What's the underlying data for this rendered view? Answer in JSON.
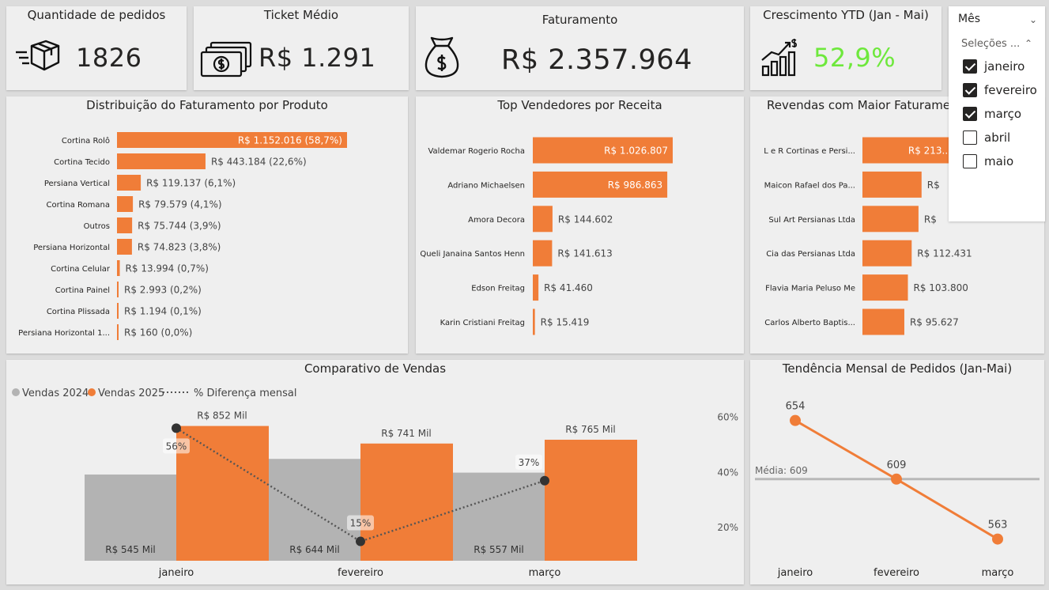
{
  "kpis": {
    "pedidos": {
      "title": "Quantidade de pedidos",
      "value": "1826"
    },
    "ticket": {
      "title": "Ticket Médio",
      "value": "R$ 1.291"
    },
    "faturamento": {
      "title": "Faturamento",
      "value": "R$ 2.357.964"
    },
    "crescimento": {
      "title": "Crescimento YTD (Jan - Mai)",
      "value": "52,9%"
    }
  },
  "slicer": {
    "title": "Mês",
    "selection_label": "Seleções ...",
    "options": [
      {
        "label": "janeiro",
        "checked": true
      },
      {
        "label": "fevereiro",
        "checked": true
      },
      {
        "label": "março",
        "checked": true
      },
      {
        "label": "abril",
        "checked": false
      },
      {
        "label": "maio",
        "checked": false
      }
    ]
  },
  "colors": {
    "accent": "#f07d38",
    "gray": "#b3b3b3",
    "positive": "#6ee83c",
    "text": "#252423",
    "dots": "#333333"
  },
  "chart_data": [
    {
      "type": "bar",
      "orientation": "horizontal",
      "title": "Distribuição do Faturamento por Produto",
      "categories": [
        "Cortina Rolô",
        "Cortina Tecido",
        "Persiana Vertical",
        "Cortina Romana",
        "Outros",
        "Persiana Horizontal",
        "Cortina Celular",
        "Cortina Painel",
        "Cortina Plissada",
        "Persiana Horizontal 1..."
      ],
      "values": [
        1152016,
        443184,
        119137,
        79579,
        75744,
        74823,
        13994,
        2993,
        1194,
        160
      ],
      "data_labels": [
        "R$ 1.152.016 (58,7%)",
        "R$ 443.184 (22,6%)",
        "R$ 119.137 (6,1%)",
        "R$ 79.579 (4,1%)",
        "R$ 75.744 (3,9%)",
        "R$ 74.823 (3,8%)",
        "R$ 13.994 (0,7%)",
        "R$ 2.993 (0,2%)",
        "R$ 1.194 (0,1%)",
        "R$ 160 (0,0%)"
      ]
    },
    {
      "type": "bar",
      "orientation": "horizontal",
      "title": "Top Vendedores por Receita",
      "categories": [
        "Valdemar Rogerio Rocha",
        "Adriano Michaelsen",
        "Amora Decora",
        "Queli Janaina Santos Henn",
        "Edson Freitag",
        "Karin Cristiani Freitag"
      ],
      "values": [
        1026807,
        986863,
        144602,
        141613,
        41460,
        15419
      ],
      "data_labels": [
        "R$ 1.026.807",
        "R$ 986.863",
        "R$ 144.602",
        "R$ 141.613",
        "R$ 41.460",
        "R$ 15.419"
      ]
    },
    {
      "type": "bar",
      "orientation": "horizontal",
      "title": "Revendas com Maior Faturamento",
      "categories": [
        "L e R Cortinas e Persi...",
        "Maicon Rafael dos Pa...",
        "Sul Art Persianas Ltda",
        "Cia das Persianas Ltda",
        "Flavia Maria Peluso Me",
        "Carlos Alberto Baptis..."
      ],
      "values": [
        213000,
        135000,
        128000,
        112431,
        103800,
        95627
      ],
      "data_labels": [
        "R$ 213...",
        "R$",
        "R$",
        "R$ 112.431",
        "R$ 103.800",
        "R$ 95.627"
      ]
    },
    {
      "type": "bar",
      "title": "Comparativo de Vendas",
      "categories": [
        "janeiro",
        "fevereiro",
        "março"
      ],
      "series": [
        {
          "name": "Vendas 2024",
          "values": [
            545,
            644,
            557
          ],
          "labels": [
            "R$ 545 Mil",
            "R$ 644 Mil",
            "R$ 557 Mil"
          ]
        },
        {
          "name": "Vendas 2025",
          "values": [
            852,
            741,
            765
          ],
          "labels": [
            "R$ 852 Mil",
            "R$ 741 Mil",
            "R$ 765 Mil"
          ]
        }
      ],
      "line": {
        "name": "% Diferença mensal",
        "values": [
          56,
          15,
          37
        ],
        "labels": [
          "56%",
          "15%",
          "37%"
        ]
      },
      "ylim": [
        0,
        1000
      ],
      "y2_ticks": [
        "60%",
        "40%",
        "20%"
      ],
      "y2_values": [
        60,
        40,
        20
      ],
      "y2lim": [
        8,
        65
      ],
      "legend": "top-left"
    },
    {
      "type": "line",
      "title": "Tendência Mensal de Pedidos (Jan-Mai)",
      "categories": [
        "janeiro",
        "fevereiro",
        "março"
      ],
      "values": [
        654,
        609,
        563
      ],
      "labels": [
        "654",
        "609",
        "563"
      ],
      "reference": {
        "label": "Média: 609",
        "value": 609
      },
      "ylim": [
        550,
        672
      ]
    }
  ]
}
